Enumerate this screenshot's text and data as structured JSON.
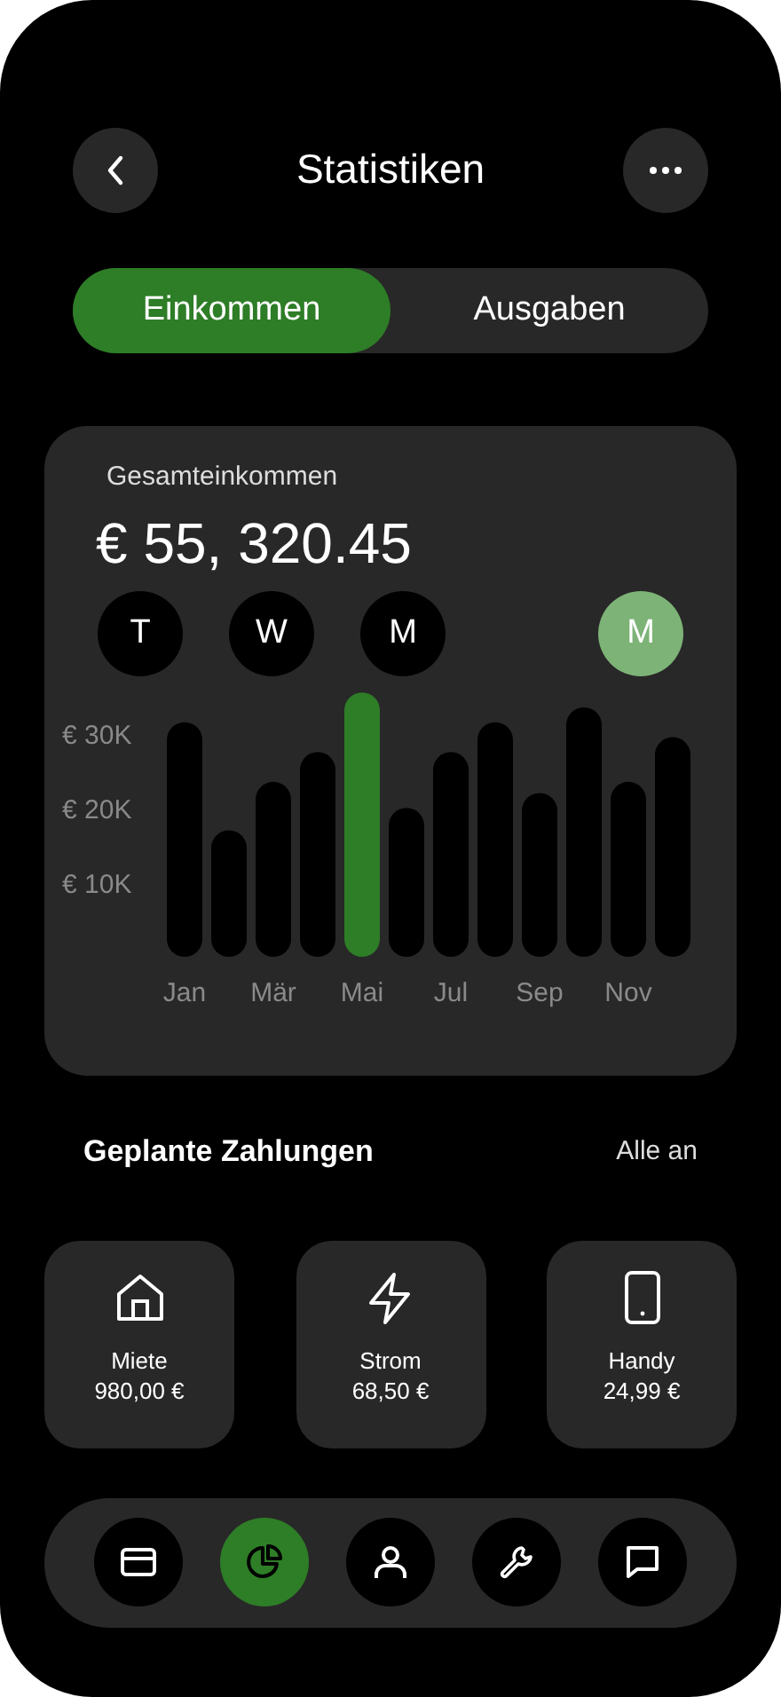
{
  "header": {
    "title": "Statistiken"
  },
  "tabs": [
    {
      "label": "Einkommen",
      "selected": true
    },
    {
      "label": "Ausgaben",
      "selected": false
    }
  ],
  "income_card": {
    "label": "Gesamteinkommen",
    "amount": "€ 55, 320.45",
    "periods": [
      {
        "label": "T",
        "selected": false
      },
      {
        "label": "W",
        "selected": false
      },
      {
        "label": "M",
        "selected": false
      },
      {
        "label": "M",
        "selected": true
      }
    ],
    "chart_data": {
      "type": "bar",
      "categories": [
        "Jan",
        null,
        "Mär",
        null,
        "Mai",
        null,
        "Jul",
        null,
        "Sep",
        null,
        "Nov",
        null
      ],
      "series": [
        {
          "color": "#000000",
          "values": [
            31500,
            17000,
            23500,
            27500,
            null,
            20000,
            27500,
            31500,
            22000,
            33500,
            23500,
            29500
          ]
        },
        {
          "color": "#2e7d27",
          "values": [
            null,
            null,
            null,
            null,
            35500,
            null,
            null,
            null,
            null,
            null,
            null,
            null
          ]
        }
      ],
      "ylim": [
        0,
        36000
      ],
      "yticks": [
        {
          "value": 10000,
          "label": "€ 10K"
        },
        {
          "value": 20000,
          "label": "€ 20K"
        },
        {
          "value": 30000,
          "label": "€ 30K"
        }
      ]
    }
  },
  "payments": {
    "title": "Geplante Zahlungen",
    "link": "Alle an",
    "items": [
      {
        "kind": "house",
        "name": "Miete",
        "amount": "980,00 €"
      },
      {
        "kind": "bolt",
        "name": "Strom",
        "amount": "68,50 €"
      },
      {
        "kind": "phone",
        "name": "Handy",
        "amount": "24,99 €"
      }
    ]
  },
  "nav": [
    {
      "kind": "card",
      "selected": false
    },
    {
      "kind": "chart",
      "selected": true
    },
    {
      "kind": "user",
      "selected": false
    },
    {
      "kind": "wrench",
      "selected": false
    },
    {
      "kind": "chat",
      "selected": false
    }
  ]
}
